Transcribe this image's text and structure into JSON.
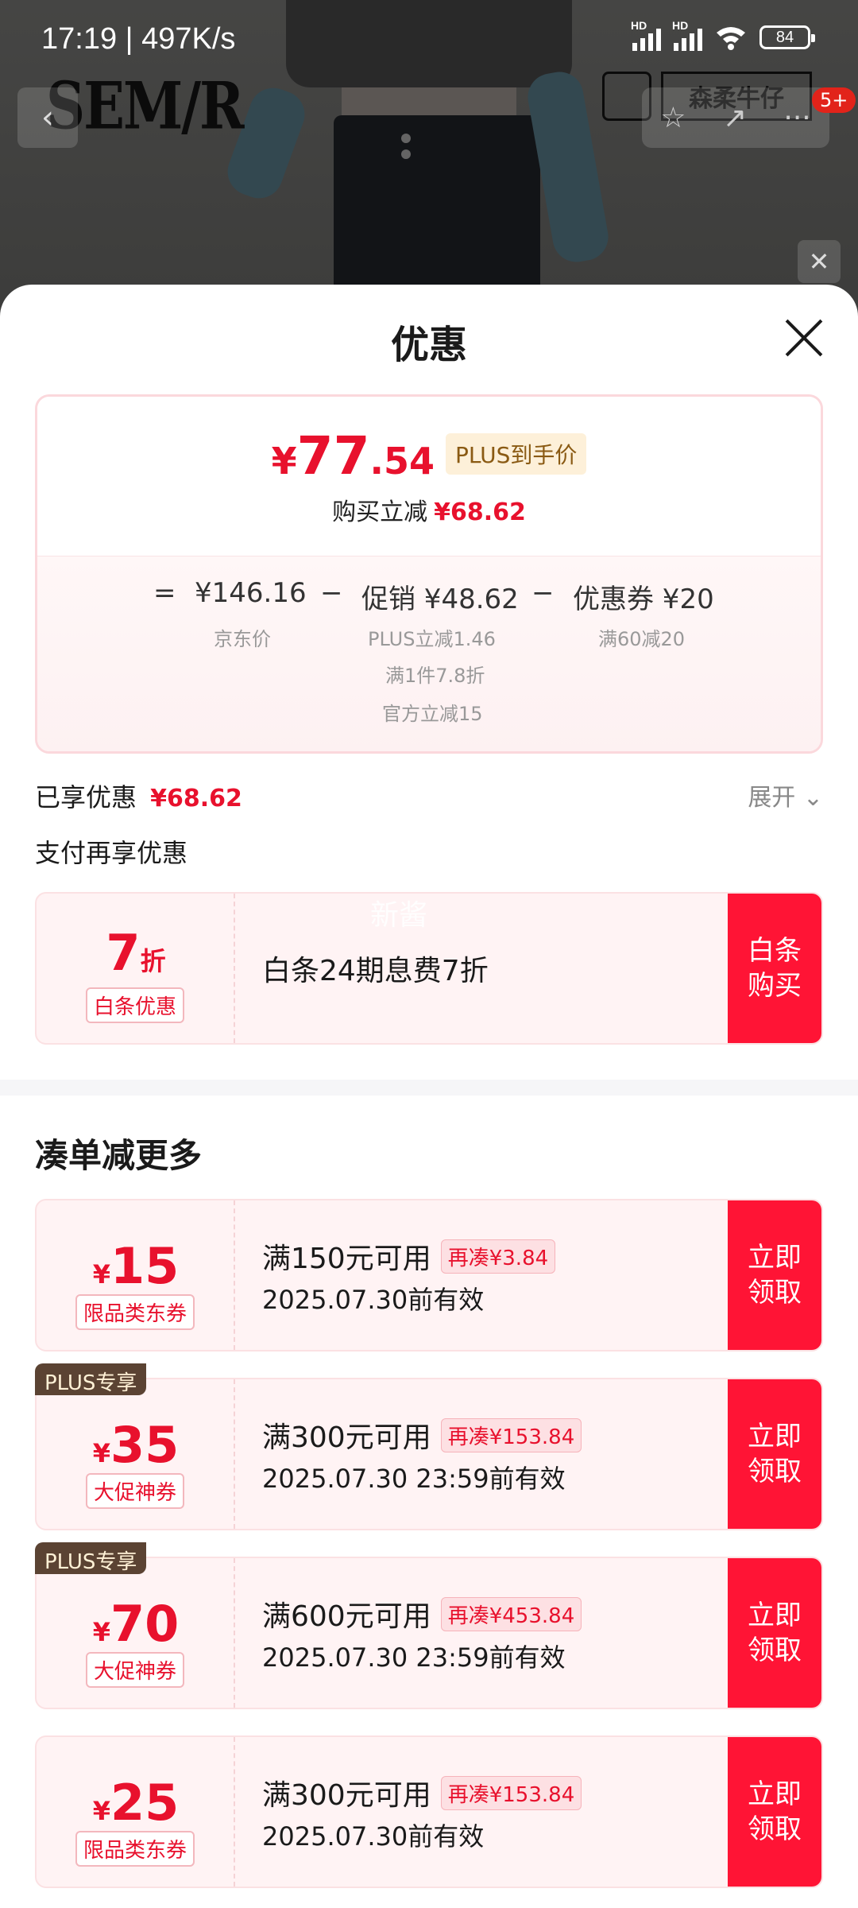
{
  "status_bar": {
    "time": "17:19 | 497K/s",
    "battery": "84",
    "sig_label": "HD"
  },
  "background": {
    "brand_logo": "SEM/R",
    "brand_box": "森柔牛仔",
    "badge": "5+"
  },
  "sheet": {
    "title": "优惠",
    "price": {
      "currency": "¥",
      "integer": "77",
      "decimal": ".54",
      "plus_tag": "PLUS到手价",
      "reduce_label": "购买立减",
      "reduce_value": "¥68.62"
    },
    "breakdown": {
      "eq": "=",
      "jd_price": "¥146.16",
      "jd_price_label": "京东价",
      "minus1": "−",
      "promo": "促销 ¥48.62",
      "promo_sub1": "PLUS立减1.46",
      "promo_sub2": "满1件7.8折",
      "promo_sub3": "官方立减15",
      "minus2": "−",
      "coupon": "优惠券 ¥20",
      "coupon_sub": "满60减20"
    },
    "enjoyed_label": "已享优惠",
    "enjoyed_value": "¥68.62",
    "expand_label": "展开",
    "pay_label": "支付再享优惠",
    "watermark": "新酱",
    "baitiao": {
      "amount": "7",
      "unit": "折",
      "kind": "白条优惠",
      "desc": "白条24期息费7折",
      "button": "白条购买"
    },
    "section_title": "凑单减更多",
    "coupons": [
      {
        "plus": "",
        "currency": "¥",
        "amount": "15",
        "kind": "限品类东券",
        "condition": "满150元可用",
        "again": "再凑¥3.84",
        "valid": "2025.07.30前有效",
        "button": "立即领取"
      },
      {
        "plus": "PLUS专享",
        "currency": "¥",
        "amount": "35",
        "kind": "大促神券",
        "condition": "满300元可用",
        "again": "再凑¥153.84",
        "valid": "2025.07.30 23:59前有效",
        "button": "立即领取"
      },
      {
        "plus": "PLUS专享",
        "currency": "¥",
        "amount": "70",
        "kind": "大促神券",
        "condition": "满600元可用",
        "again": "再凑¥453.84",
        "valid": "2025.07.30 23:59前有效",
        "button": "立即领取"
      },
      {
        "plus": "",
        "currency": "¥",
        "amount": "25",
        "kind": "限品类东券",
        "condition": "满300元可用",
        "again": "再凑¥153.84",
        "valid": "2025.07.30前有效",
        "button": "立即领取"
      }
    ]
  },
  "colors": {
    "accent": "#e8112d",
    "button": "#ff1435",
    "plus_corner": "#5b4333"
  }
}
